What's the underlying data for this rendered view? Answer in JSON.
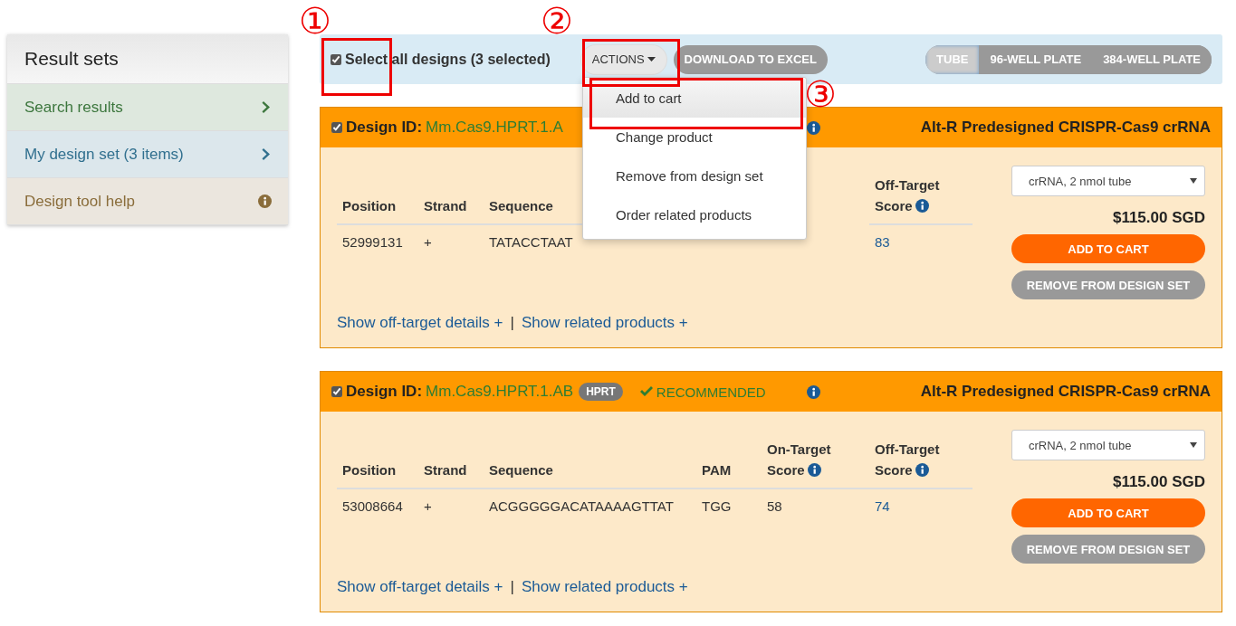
{
  "sidebar": {
    "title": "Result sets",
    "items": [
      {
        "label": "Search results",
        "color": "#3c763d",
        "kind": "link"
      },
      {
        "label": "My design set (3 items)",
        "color": "#31708f",
        "kind": "link"
      },
      {
        "label": "Design tool help",
        "color": "#8a6d3b",
        "kind": "help"
      }
    ]
  },
  "toolbar": {
    "select_all": {
      "label": "Select all designs (3 selected)",
      "checked": true
    },
    "actions_button": "ACTIONS",
    "download_button": "DOWNLOAD TO EXCEL",
    "formats": [
      {
        "label": "TUBE",
        "selected": true
      },
      {
        "label": "96-WELL PLATE",
        "selected": false
      },
      {
        "label": "384-WELL PLATE",
        "selected": false
      }
    ]
  },
  "actions_menu": {
    "items": [
      {
        "label": "Add to cart",
        "selected": true
      },
      {
        "label": "Change product",
        "selected": false
      },
      {
        "label": "Remove from design set",
        "selected": false
      },
      {
        "label": "Order related products",
        "selected": false
      }
    ]
  },
  "cards": [
    {
      "checked": true,
      "id_label": "Design ID:",
      "design_id": "Mm.Cas9.HPRT.1.A",
      "info": true,
      "product": "Alt-R Predesigned CRISPR-Cas9 crRNA",
      "columns": [
        {
          "label": "Position",
          "kind": "position"
        },
        {
          "label": "Strand",
          "kind": "strand"
        },
        {
          "label": "Sequence",
          "kind": "sequence"
        },
        {
          "label": "Off-Target Score",
          "kind": "off_target",
          "info": true
        }
      ],
      "rows": [
        [
          "52999131",
          "+",
          "TATACCTAAT",
          "83"
        ]
      ],
      "option": "crRNA, 2 nmol tube",
      "price": "$115.00 SGD",
      "add_button": "ADD TO CART",
      "remove_button": "REMOVE FROM DESIGN SET",
      "links": [
        "Show off-target details +",
        "Show related products +"
      ],
      "separator": "|"
    },
    {
      "checked": true,
      "id_label": "Design ID:",
      "design_id": "Mm.Cas9.HPRT.1.AB",
      "badge": "HPRT",
      "recommended": "RECOMMENDED",
      "info": true,
      "product": "Alt-R Predesigned CRISPR-Cas9 crRNA",
      "columns": [
        {
          "label": "Position",
          "kind": "position"
        },
        {
          "label": "Strand",
          "kind": "strand"
        },
        {
          "label": "Sequence",
          "kind": "sequence"
        },
        {
          "label": "PAM",
          "kind": "pam"
        },
        {
          "label": "On-Target Score",
          "kind": "on_target",
          "info": true
        },
        {
          "label": "Off-Target Score",
          "kind": "off_target",
          "info": true
        }
      ],
      "rows": [
        [
          "53008664",
          "+",
          "ACGGGGGACATAAAAGTTAT",
          "TGG",
          "58",
          "74"
        ]
      ],
      "option": "crRNA, 2 nmol tube",
      "price": "$115.00 SGD",
      "add_button": "ADD TO CART",
      "remove_button": "REMOVE FROM DESIGN SET",
      "links": [
        "Show off-target details +",
        "Show related products +"
      ],
      "separator": "|"
    }
  ],
  "annotations": [
    {
      "label": "①"
    },
    {
      "label": "②"
    },
    {
      "label": "③"
    }
  ]
}
